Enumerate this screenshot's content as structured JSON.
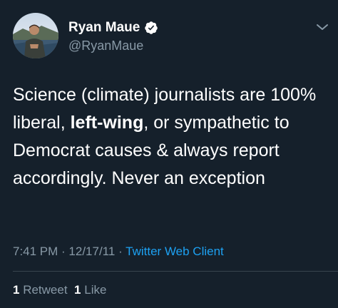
{
  "author": {
    "display_name": "Ryan Maue",
    "handle": "@RyanMaue",
    "verified": true,
    "avatar_icon": "profile-photo"
  },
  "tweet": {
    "text_before": "Science (climate) journalists are 100% liberal, ",
    "text_bold": "left-wing",
    "text_after": ", or sympathetic to Democrat causes & always report accordingly. Never an exception"
  },
  "meta": {
    "time": "7:41 PM",
    "separator1": " · ",
    "date": "12/17/11",
    "separator2": " · ",
    "source": "Twitter Web Client"
  },
  "stats": {
    "retweet_count": "1",
    "retweet_label": "Retweet",
    "like_count": "1",
    "like_label": "Like"
  },
  "colors": {
    "background": "#15202b",
    "text": "#ffffff",
    "secondary": "#8899a6",
    "accent": "#1da1f2"
  }
}
